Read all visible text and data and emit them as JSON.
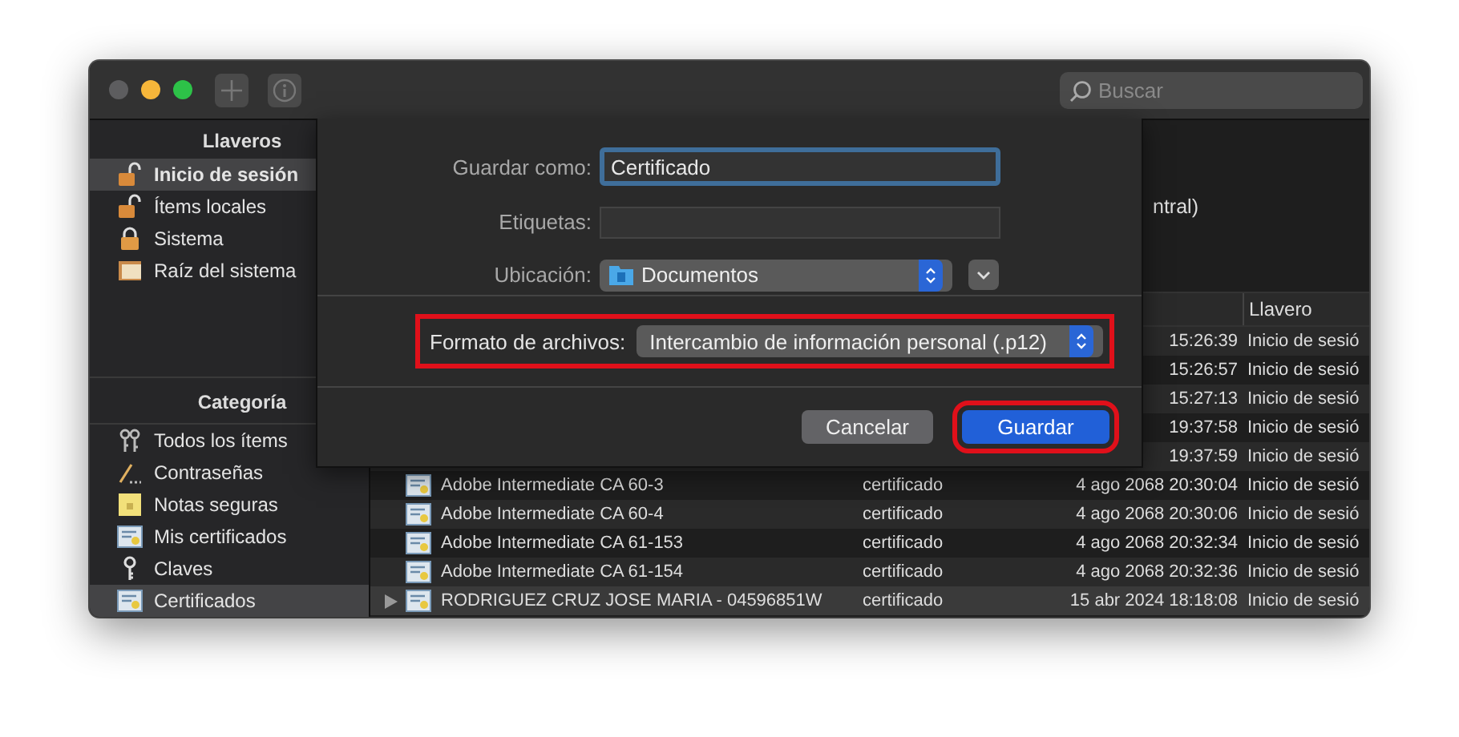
{
  "toolbar": {
    "search": {
      "placeholder": "Buscar"
    }
  },
  "sidebar": {
    "keychains": {
      "title": "Llaveros",
      "items": [
        {
          "label": "Inicio de sesión",
          "selected": true
        },
        {
          "label": "Ítems locales",
          "selected": false
        },
        {
          "label": "Sistema",
          "selected": false
        },
        {
          "label": "Raíz del sistema",
          "selected": false
        }
      ]
    },
    "categories": {
      "title": "Categoría",
      "items": [
        {
          "label": "Todos los ítems",
          "selected": false
        },
        {
          "label": "Contraseñas",
          "selected": false
        },
        {
          "label": "Notas seguras",
          "selected": false
        },
        {
          "label": "Mis certificados",
          "selected": false
        },
        {
          "label": "Claves",
          "selected": false
        },
        {
          "label": "Certificados",
          "selected": true
        }
      ]
    }
  },
  "info": {
    "text": "ntral)"
  },
  "table": {
    "columns": [
      {
        "label": "Llavero"
      }
    ],
    "rows": [
      {
        "date": "15:26:39",
        "keychain": "Inicio de sesió",
        "selected": false
      },
      {
        "date": "15:26:57",
        "keychain": "Inicio de sesió",
        "selected": false
      },
      {
        "date": "15:27:13",
        "keychain": "Inicio de sesió",
        "selected": false
      },
      {
        "date": "19:37:58",
        "keychain": "Inicio de sesió",
        "selected": false
      },
      {
        "date": "19:37:59",
        "keychain": "Inicio de sesió",
        "selected": false
      },
      {
        "name": "Adobe Intermediate CA 60-3",
        "kind": "certificado",
        "date": "4 ago 2068 20:30:04",
        "keychain": "Inicio de sesió",
        "selected": false,
        "expandable": false
      },
      {
        "name": "Adobe Intermediate CA 60-4",
        "kind": "certificado",
        "date": "4 ago 2068 20:30:06",
        "keychain": "Inicio de sesió",
        "selected": false,
        "expandable": false
      },
      {
        "name": "Adobe Intermediate CA 61-153",
        "kind": "certificado",
        "date": "4 ago 2068 20:32:34",
        "keychain": "Inicio de sesió",
        "selected": false,
        "expandable": false
      },
      {
        "name": "Adobe Intermediate CA 61-154",
        "kind": "certificado",
        "date": "4 ago 2068 20:32:36",
        "keychain": "Inicio de sesió",
        "selected": false,
        "expandable": false
      },
      {
        "name": "RODRIGUEZ CRUZ JOSE MARIA - 04596851W",
        "kind": "certificado",
        "date": "15 abr 2024 18:18:08",
        "keychain": "Inicio de sesió",
        "selected": true,
        "expandable": true
      }
    ]
  },
  "save_sheet": {
    "save_as": {
      "label": "Guardar como:",
      "value": "Certificado"
    },
    "tags": {
      "label": "Etiquetas:"
    },
    "location": {
      "label": "Ubicación:",
      "value": "Documentos"
    },
    "format": {
      "label": "Formato de archivos:",
      "value": "Intercambio de información personal (.p12)",
      "highlighted": true
    },
    "buttons": [
      {
        "label": "Cancelar",
        "kind": "cancel",
        "highlighted": false
      },
      {
        "label": "Guardar",
        "kind": "default",
        "highlighted": true
      }
    ]
  }
}
